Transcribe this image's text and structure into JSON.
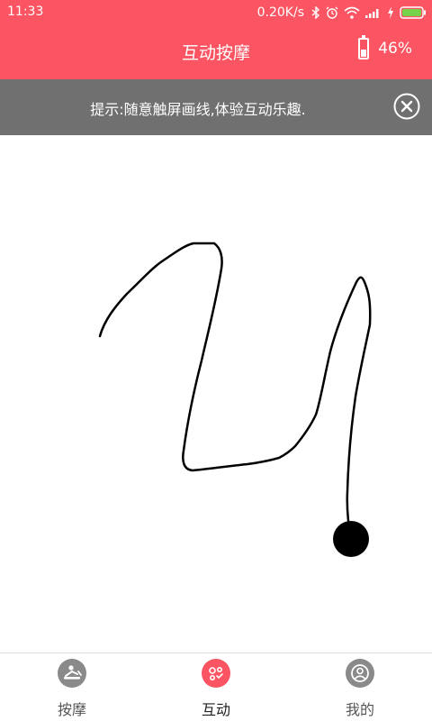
{
  "status_bar": {
    "time": "11:33",
    "network_speed": "0.20K/s",
    "icons": [
      "bluetooth-icon",
      "alarm-icon",
      "wifi-icon",
      "signal-icon",
      "charging-icon",
      "battery-icon"
    ],
    "battery_color": "#76d24a"
  },
  "header": {
    "title": "互动按摩",
    "battery_percent": "46%",
    "battery_level": 0.46
  },
  "tip": {
    "text": "提示:随意触屏画线,体验互动乐趣.",
    "close_icon": "close-circle-icon"
  },
  "colors": {
    "accent": "#fb5462",
    "tip_background": "#707070",
    "nav_inactive": "#8a8a8a"
  },
  "bottom_nav": {
    "items": [
      {
        "label": "按摩",
        "icon": "massage-icon",
        "active": false
      },
      {
        "label": "互动",
        "icon": "interact-icon",
        "active": true
      },
      {
        "label": "我的",
        "icon": "profile-icon",
        "active": false
      }
    ]
  }
}
